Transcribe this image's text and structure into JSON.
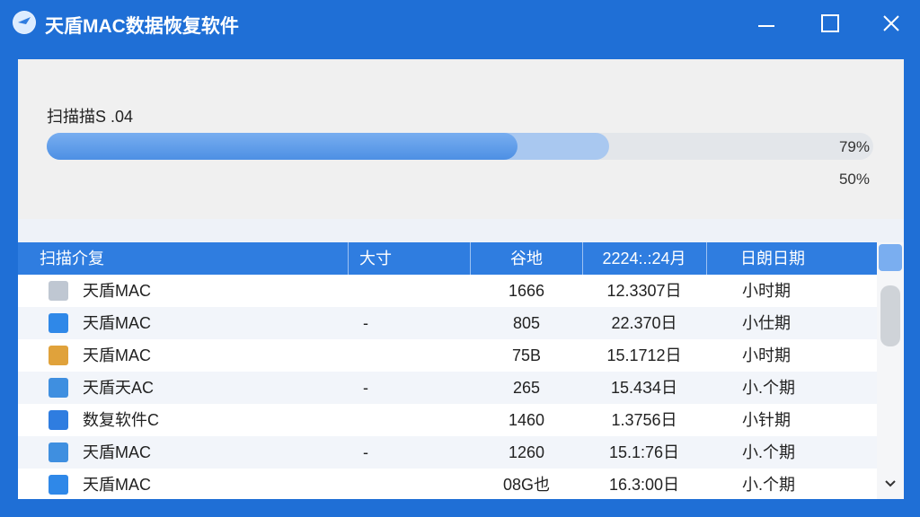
{
  "window": {
    "title": "天盾MAC数据恢复软件"
  },
  "scan": {
    "label": "扫描描S .04",
    "percent_primary": "79%",
    "percent_secondary": "50%",
    "progress_fill_fraction": 0.57,
    "progress_secondary_fraction": 0.68
  },
  "table": {
    "headers": [
      "扫描介复",
      "大寸",
      "谷地",
      "2224:.:24月",
      "日朗日期"
    ],
    "rows": [
      {
        "name": "天盾MAC",
        "size": "",
        "count": "1666",
        "date": "12.3307日",
        "type": "小时期",
        "icon": "document-icon",
        "color": "#bfc7d2"
      },
      {
        "name": "天盾MAC",
        "size": "-",
        "count": "805",
        "date": "22.370日",
        "type": "小仕期",
        "icon": "cloud-icon",
        "color": "#2f88e8"
      },
      {
        "name": "天盾MAC",
        "size": "",
        "count": "75B",
        "date": "15.1712日",
        "type": "小时期",
        "icon": "photo-icon",
        "color": "#e0a23b"
      },
      {
        "name": "天盾天AC",
        "size": "-",
        "count": "265",
        "date": "15.4З4日",
        "type": "小.个期",
        "icon": "mail-icon",
        "color": "#3f8fe0"
      },
      {
        "name": "数复软件C",
        "size": "",
        "count": "1460",
        "date": "1.3756日",
        "type": "小针期",
        "icon": "image-icon",
        "color": "#2f7de0"
      },
      {
        "name": "天盾MAC",
        "size": "-",
        "count": "1260",
        "date": "15.1:76日",
        "type": "小.个期",
        "icon": "file-icon",
        "color": "#3f8fe0"
      },
      {
        "name": "天盾MAC",
        "size": "",
        "count": "08G也",
        "date": "16.3:00日",
        "type": "小.个期",
        "icon": "file-icon",
        "color": "#2f88e8"
      }
    ]
  }
}
